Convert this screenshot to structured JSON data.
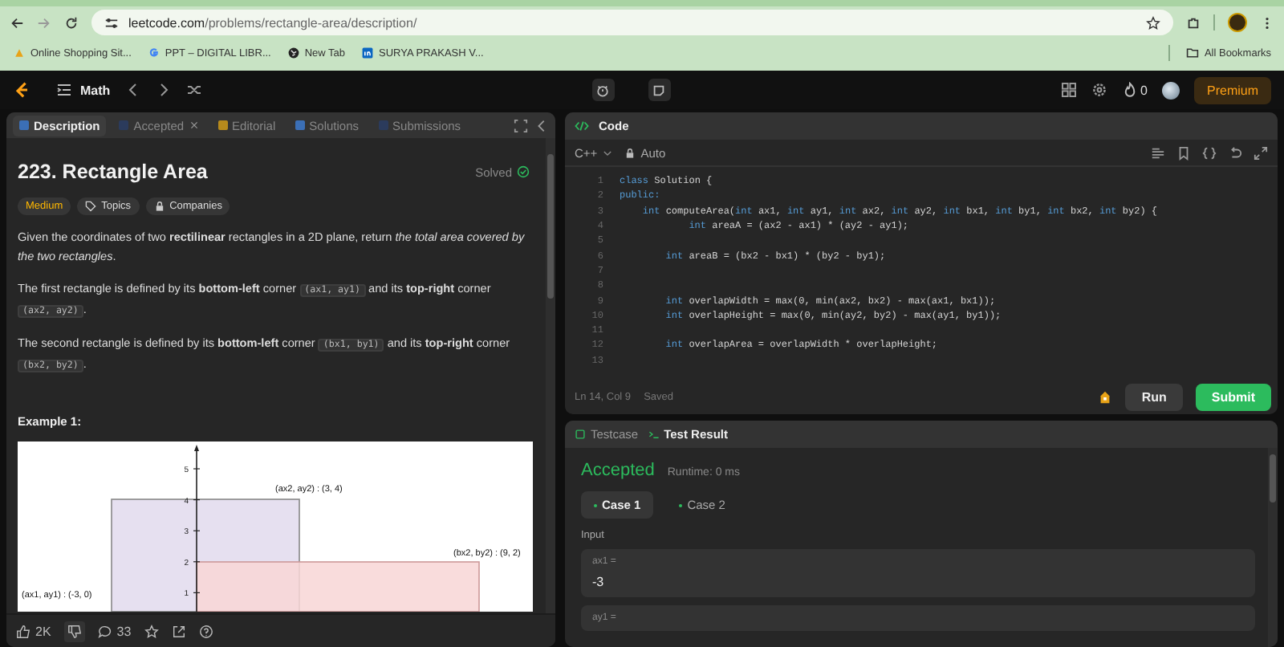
{
  "browser": {
    "url_host": "leetcode.com",
    "url_path": "/problems/rectangle-area/description/",
    "bookmarks": [
      {
        "label": "Online Shopping Sit..."
      },
      {
        "label": "PPT – DIGITAL LIBR..."
      },
      {
        "label": "New Tab"
      },
      {
        "label": "SURYA PRAKASH V..."
      }
    ],
    "all_bookmarks": "All Bookmarks"
  },
  "nav": {
    "list": "Math",
    "streak": "0",
    "premium": "Premium"
  },
  "left": {
    "tabs": [
      {
        "label": "Description",
        "selected": true,
        "closable": false
      },
      {
        "label": "Accepted",
        "selected": false,
        "closable": true
      },
      {
        "label": "Editorial",
        "selected": false,
        "closable": false
      },
      {
        "label": "Solutions",
        "selected": false,
        "closable": false
      },
      {
        "label": "Submissions",
        "selected": false,
        "closable": false
      }
    ],
    "title": "223. Rectangle Area",
    "status": "Solved",
    "tags": [
      {
        "label": "Medium",
        "kind": "difficulty"
      },
      {
        "label": "Topics",
        "kind": "topics"
      },
      {
        "label": "Companies",
        "kind": "companies"
      }
    ],
    "paragraphs": [
      [
        {
          "kind": "text",
          "text": "Given the coordinates of two **rectilinear** rectangles in a 2D plane, return *the total area covered by the two rectangles*."
        }
      ],
      [
        {
          "kind": "text",
          "text": "The first rectangle is defined by its **bottom-left** corner "
        },
        {
          "kind": "code",
          "text": "(ax1, ay1)"
        },
        {
          "kind": "text",
          "text": " and its **top-right** corner "
        },
        {
          "kind": "code",
          "text": "(ax2, ay2)"
        },
        {
          "kind": "text",
          "text": "."
        }
      ],
      [
        {
          "kind": "text",
          "text": "The second rectangle is defined by its **bottom-left** corner "
        },
        {
          "kind": "code",
          "text": "(bx1, by1)"
        },
        {
          "kind": "text",
          "text": " and its **top-right** corner "
        },
        {
          "kind": "code",
          "text": "(bx2, by2)"
        },
        {
          "kind": "text",
          "text": "."
        }
      ]
    ],
    "example_heading": "Example 1:",
    "figure": {
      "y_tick_labels": [
        "5",
        "4",
        "3",
        "2",
        "1"
      ],
      "label_a_top": "(ax2, ay2) : (3, 4)",
      "label_b_top": "(bx2, by2) : (9, 2)",
      "label_a_bottom": "(ax1, ay1) : (-3, 0)"
    },
    "likes": "2K",
    "comments": "33"
  },
  "code": {
    "title": "Code",
    "language": "C++",
    "mode": "Auto",
    "lines": [
      {
        "n": "1",
        "segs": [
          {
            "kind": "keyword",
            "t": "class"
          },
          {
            "kind": "plain",
            "t": " Solution {"
          }
        ]
      },
      {
        "n": "2",
        "segs": [
          {
            "kind": "keyword",
            "t": "public:"
          }
        ]
      },
      {
        "n": "3",
        "segs": [
          {
            "kind": "keyword",
            "t": "    int"
          },
          {
            "kind": "plain",
            "t": " computeArea("
          },
          {
            "kind": "keyword",
            "t": "int"
          },
          {
            "kind": "plain",
            "t": " ax1, "
          },
          {
            "kind": "keyword",
            "t": "int"
          },
          {
            "kind": "plain",
            "t": " ay1, "
          },
          {
            "kind": "keyword",
            "t": "int"
          },
          {
            "kind": "plain",
            "t": " ax2, "
          },
          {
            "kind": "keyword",
            "t": "int"
          },
          {
            "kind": "plain",
            "t": " ay2, "
          },
          {
            "kind": "keyword",
            "t": "int"
          },
          {
            "kind": "plain",
            "t": " bx1, "
          },
          {
            "kind": "keyword",
            "t": "int"
          },
          {
            "kind": "plain",
            "t": " by1, "
          },
          {
            "kind": "keyword",
            "t": "int"
          },
          {
            "kind": "plain",
            "t": " bx2, "
          },
          {
            "kind": "keyword",
            "t": "int"
          },
          {
            "kind": "plain",
            "t": " by2) {"
          }
        ]
      },
      {
        "n": "4",
        "segs": [
          {
            "kind": "keyword",
            "t": "            int"
          },
          {
            "kind": "plain",
            "t": " areaA = (ax2 - ax1) * (ay2 - ay1);"
          }
        ]
      },
      {
        "n": "5"
      },
      {
        "n": "6",
        "segs": [
          {
            "kind": "keyword",
            "t": "        int"
          },
          {
            "kind": "plain",
            "t": " areaB = (bx2 - bx1) * (by2 - by1);"
          }
        ]
      },
      {
        "n": "7"
      },
      {
        "n": "8"
      },
      {
        "n": "9",
        "segs": [
          {
            "kind": "keyword",
            "t": "        int"
          },
          {
            "kind": "plain",
            "t": " overlapWidth = max(0, min(ax2, bx2) - max(ax1, bx1));"
          }
        ]
      },
      {
        "n": "10",
        "segs": [
          {
            "kind": "keyword",
            "t": "        int"
          },
          {
            "kind": "plain",
            "t": " overlapHeight = max(0, min(ay2, by2) - max(ay1, by1));"
          }
        ]
      },
      {
        "n": "11"
      },
      {
        "n": "12",
        "segs": [
          {
            "kind": "keyword",
            "t": "        int"
          },
          {
            "kind": "plain",
            "t": " overlapArea = overlapWidth * overlapHeight;"
          }
        ]
      },
      {
        "n": "13"
      }
    ],
    "cursor": "Ln 14, Col 9",
    "saved": "Saved",
    "run": "Run",
    "submit": "Submit"
  },
  "tests": {
    "tabs": [
      {
        "label": "Testcase",
        "selected": false
      },
      {
        "label": "Test Result",
        "selected": true
      }
    ],
    "verdict": "Accepted",
    "runtime": "Runtime: 0 ms",
    "cases": [
      {
        "label": "Case 1",
        "selected": true
      },
      {
        "label": "Case 2",
        "selected": false
      }
    ],
    "input_label": "Input",
    "inputs": [
      {
        "name": "ax1 =",
        "value": "-3"
      },
      {
        "name": "ay1 ="
      }
    ]
  }
}
